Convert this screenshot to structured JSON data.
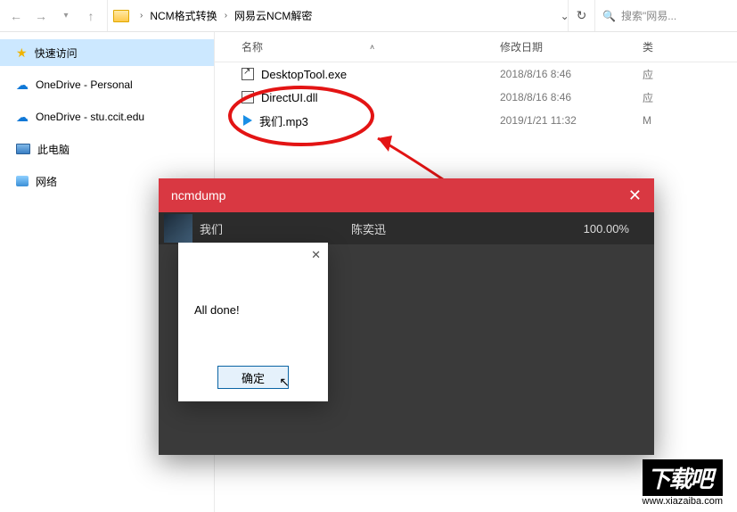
{
  "addrbar": {
    "crumbs": [
      "NCM格式转换",
      "网易云NCM解密"
    ],
    "search_placeholder": "搜索\"网易..."
  },
  "sidebar": {
    "items": [
      {
        "label": "快速访问",
        "icon": "star"
      },
      {
        "label": "OneDrive - Personal",
        "icon": "cloud"
      },
      {
        "label": "OneDrive - stu.ccit.edu",
        "icon": "cloud"
      },
      {
        "label": "此电脑",
        "icon": "pc"
      },
      {
        "label": "网络",
        "icon": "net"
      }
    ]
  },
  "columns": {
    "name": "名称",
    "date": "修改日期",
    "type": "类"
  },
  "files": [
    {
      "name": "DesktopTool.exe",
      "icon": "exe",
      "date": "2018/8/16 8:46",
      "type": "应"
    },
    {
      "name": "DirectUI.dll",
      "icon": "dll",
      "date": "2018/8/16 8:46",
      "type": "应"
    },
    {
      "name": "我们.mp3",
      "icon": "mp3",
      "date": "2019/1/21 11:32",
      "type": "M"
    }
  ],
  "ncmdump": {
    "title": "ncmdump",
    "song": "我们",
    "artist": "陈奕迅",
    "percent": "100.00%"
  },
  "popup": {
    "message": "All done!",
    "ok": "确定"
  },
  "watermark": {
    "badge": "下载吧",
    "url": "www.xiazaiba.com"
  }
}
